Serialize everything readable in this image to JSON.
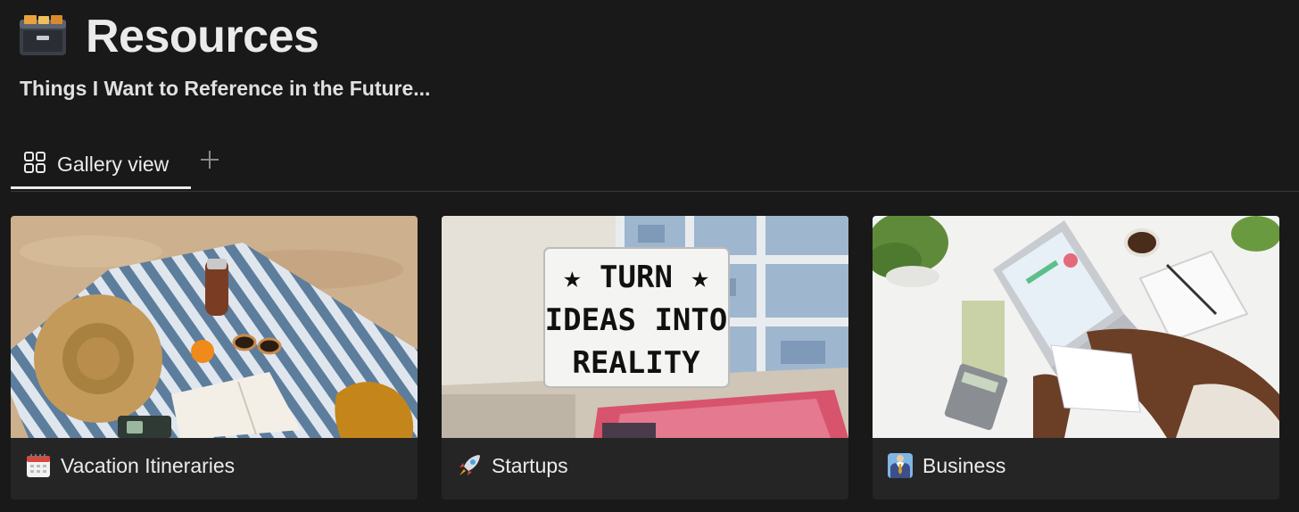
{
  "page": {
    "icon": "card-file-box-icon",
    "title": "Resources",
    "subtitle": "Things I Want to Reference in the Future..."
  },
  "views": {
    "active_tab": {
      "icon": "gallery-grid-icon",
      "label": "Gallery view"
    },
    "add_icon": "plus-icon"
  },
  "cards": [
    {
      "title": "Vacation Itineraries",
      "icon": "calendar-icon",
      "cover": "beach-towel-hat-book-photo"
    },
    {
      "title": "Startups",
      "icon": "rocket-icon",
      "cover": "lightbox-sign-photo",
      "cover_text": [
        "★ TURN ★",
        "IDEAS INTO",
        "REALITY"
      ]
    },
    {
      "title": "Business",
      "icon": "business-suit-icon",
      "cover": "desk-laptop-calculator-photo"
    }
  ],
  "colors": {
    "background": "#191919",
    "card": "#252525",
    "text": "#ebebeb",
    "divider": "#373737"
  }
}
